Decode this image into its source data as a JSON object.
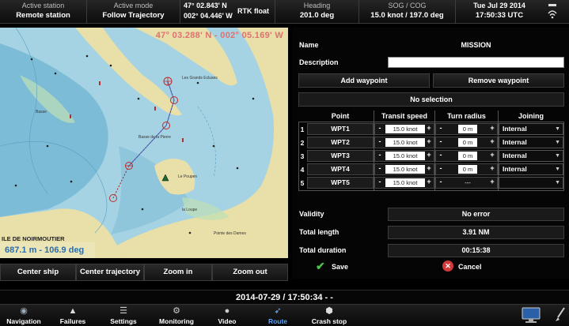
{
  "topbar": {
    "active_station_label": "Active station",
    "active_station_value": "Remote station",
    "active_mode_label": "Active mode",
    "active_mode_value": "Follow Trajectory",
    "lat": "47° 02.843' N",
    "lon": "002° 04.446' W",
    "fix": "RTK float",
    "heading_label": "Heading",
    "heading_value": "201.0 deg",
    "sog_cog_label": "SOG / COG",
    "sog_cog_value": "15.0 knot / 197.0 deg",
    "date_label": "Tue Jul 29 2014",
    "time_value": "17:50:33 UTC"
  },
  "map": {
    "coords": "47° 03.288' N - 002° 05.169' W",
    "range": "687.1 m - 106.9 deg",
    "place_label": "ILE DE NOIRMOUTIER",
    "water_color": "#a5d3e3",
    "deep_water_color": "#7cbcd6",
    "land_color": "#e8dfa9"
  },
  "map_buttons": {
    "center_ship": "Center ship",
    "center_trajectory": "Center trajectory",
    "zoom_in": "Zoom in",
    "zoom_out": "Zoom out"
  },
  "panel": {
    "name_label": "Name",
    "name_value": "MISSION",
    "description_label": "Description",
    "description_value": "",
    "add_waypoint": "Add waypoint",
    "remove_waypoint": "Remove waypoint",
    "selection_status": "No selection",
    "columns": [
      "Point",
      "Transit speed",
      "Turn radius",
      "Joining"
    ],
    "waypoints": [
      {
        "index": "1",
        "name": "WPT1",
        "speed": "15.0 knot",
        "radius": "0 m",
        "joining": "Internal"
      },
      {
        "index": "2",
        "name": "WPT2",
        "speed": "15.0 knot",
        "radius": "0 m",
        "joining": "Internal"
      },
      {
        "index": "3",
        "name": "WPT3",
        "speed": "15.0 knot",
        "radius": "0 m",
        "joining": "Internal"
      },
      {
        "index": "4",
        "name": "WPT4",
        "speed": "15.0 knot",
        "radius": "0 m",
        "joining": "Internal"
      },
      {
        "index": "5",
        "name": "WPT5",
        "speed": "15.0 knot",
        "radius": "---",
        "joining": ""
      }
    ],
    "validity_label": "Validity",
    "validity_value": "No error",
    "total_length_label": "Total length",
    "total_length_value": "3.91 NM",
    "total_duration_label": "Total duration",
    "total_duration_value": "00:15:38",
    "save": "Save",
    "cancel": "Cancel"
  },
  "datebar": {
    "text": "2014-07-29 / 17:50:34 - -"
  },
  "nav": {
    "items": [
      {
        "label": "Navigation",
        "icon": "compass-icon"
      },
      {
        "label": "Failures",
        "icon": "warning-icon"
      },
      {
        "label": "Settings",
        "icon": "settings-icon"
      },
      {
        "label": "Monitoring",
        "icon": "monitoring-icon"
      },
      {
        "label": "Video",
        "icon": "video-icon"
      },
      {
        "label": "Route",
        "icon": "route-icon"
      },
      {
        "label": "Crash stop",
        "icon": "crash-stop-icon"
      }
    ],
    "active_index": 5
  }
}
